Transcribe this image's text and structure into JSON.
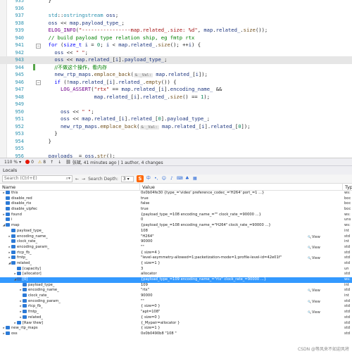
{
  "editor": {
    "lines": [
      {
        "n": "935",
        "html": "  }"
      },
      {
        "n": "936",
        "html": ""
      },
      {
        "n": "937",
        "html": "  <span class=\"ty\">std</span>::<span class=\"ty\">ostringstream</span> <span class=\"var\">oss</span>;"
      },
      {
        "n": "938",
        "html": "  <span class=\"var\">oss</span> << <span class=\"var\">map</span>.<span class=\"var\">payload_type_</span>;"
      },
      {
        "n": "939",
        "html": "  <span class=\"mac\">ELOG_INFO</span>(<span class=\"st\">\"----------------map.related_.size: %d\"</span>, <span class=\"var\">map</span>.<span class=\"var\">related_</span>.<span class=\"fn\">size</span>());"
      },
      {
        "n": "940",
        "html": "  <span class=\"cm\">// build payload type relation ship, eg fmtp rtx</span>"
      },
      {
        "n": "941",
        "html": "  <span class=\"kw\">for</span> (<span class=\"kw\">size_t</span> <span class=\"var\">i</span> = <span class=\"num\">0</span>; <span class=\"var\">i</span> < <span class=\"var\">map</span>.<span class=\"var\">related_</span>.<span class=\"fn\">size</span>(); ++<span class=\"var\">i</span>) {"
      },
      {
        "n": "942",
        "html": "    <span class=\"var\">oss</span> << <span class=\"st\">\" \"</span>;"
      },
      {
        "n": "943",
        "html": "    <span class=\"var\">oss</span> << <span class=\"var\">map</span>.<span class=\"var\">related_</span>[<span class=\"var\">i</span>].<span class=\"var\">payload_type_</span>;",
        "hl": true
      },
      {
        "n": "944",
        "html": "    <span class=\"cm-cn\">//不做这个操作，看内存</span>"
      },
      {
        "n": "945",
        "html": "    <span class=\"var\">new_rtp_maps</span>.<span class=\"fn\">emplace_back</span>(<span class=\"hint\">&amp; _Val:</span> <span class=\"var\">map</span>.<span class=\"var\">related_</span>[<span class=\"var\">i</span>]);"
      },
      {
        "n": "946",
        "html": "    <span class=\"kw\">if</span> (!<span class=\"var\">map</span>.<span class=\"var\">related_</span>[<span class=\"var\">i</span>].<span class=\"var\">related_</span>.<span class=\"fn\">empty</span>()) {"
      },
      {
        "n": "947",
        "html": "      <span class=\"mac\">LOG_ASSERT</span>(<span class=\"st\">\"rtx\"</span> == <span class=\"var\">map</span>.<span class=\"var\">related_</span>[<span class=\"var\">i</span>].<span class=\"var\">encoding_name_</span> &amp;&amp;"
      },
      {
        "n": "948",
        "html": "                 <span class=\"var\">map</span>.<span class=\"var\">related_</span>[<span class=\"var\">i</span>].<span class=\"var\">related_</span>.<span class=\"fn\">size</span>() == <span class=\"num\">1</span>);"
      },
      {
        "n": "949",
        "html": ""
      },
      {
        "n": "950",
        "html": "      <span class=\"var\">oss</span> << <span class=\"st\">\" \"</span>;"
      },
      {
        "n": "951",
        "html": "      <span class=\"var\">oss</span> << <span class=\"var\">map</span>.<span class=\"var\">related_</span>[<span class=\"var\">i</span>].<span class=\"var\">related_</span>[<span class=\"num\">0</span>].<span class=\"var\">payload_type_</span>;"
      },
      {
        "n": "952",
        "html": "      <span class=\"var\">new_rtp_maps</span>.<span class=\"fn\">emplace_back</span>(<span class=\"hint\">&amp; _Val:</span> <span class=\"var\">map</span>.<span class=\"var\">related_</span>[<span class=\"var\">i</span>].<span class=\"var\">related_</span>[<span class=\"num\">0</span>]);"
      },
      {
        "n": "953",
        "html": "    }"
      },
      {
        "n": "954",
        "html": "  }"
      },
      {
        "n": "955",
        "html": ""
      },
      {
        "n": "956",
        "html": "  <span class=\"var\">payloads_</span> = <span class=\"var\">oss</span>.<span class=\"fn\">str</span>();"
      },
      {
        "n": "957",
        "html": ""
      }
    ]
  },
  "strip": {
    "zoom": "110 %",
    "errors": "0",
    "warnings": "8",
    "nav_up": "↑",
    "nav_down": "↓",
    "blame": "张斌, 41 minutes ago | 1 author, 4 changes"
  },
  "locals": {
    "title": "Locals",
    "search_placeholder": "Search (Ctrl+E)",
    "search_depth_label": "Search Depth:",
    "search_depth_value": "3",
    "col_name": "Name",
    "col_value": "Value",
    "col_type": "Typ",
    "rows": [
      {
        "indent": 0,
        "tw": "▸",
        "name": "this",
        "value": "0x0b04fe30 {type_='video' preference_codec_='H264' port_=1 ...}",
        "type": "ws:",
        "view": ""
      },
      {
        "indent": 0,
        "tw": "",
        "name": "disable_red",
        "value": "true",
        "type": "boc",
        "view": ""
      },
      {
        "indent": 0,
        "tw": "",
        "name": "disable_rtx",
        "value": "false",
        "type": "boc",
        "view": ""
      },
      {
        "indent": 0,
        "tw": "",
        "name": "disable_ulpfec",
        "value": "true",
        "type": "boc",
        "view": ""
      },
      {
        "indent": 0,
        "tw": "▸",
        "name": "found",
        "value": "{payload_type_=108 encoding_name_=\"\" clock_rate_=90000 ...}",
        "type": "ws:",
        "view": ""
      },
      {
        "indent": 0,
        "tw": "",
        "name": "i",
        "value": "0",
        "type": "uns",
        "view": ""
      },
      {
        "indent": 0,
        "tw": "◢",
        "name": "map",
        "value": "{payload_type_=108 encoding_name_=\"H264\" clock_rate_=90000 ...}",
        "type": "ws:",
        "view": ""
      },
      {
        "indent": 1,
        "tw": "",
        "name": "payload_type_",
        "value": "108",
        "type": "int",
        "view": ""
      },
      {
        "indent": 1,
        "tw": "▸",
        "name": "encoding_name_",
        "value": "\"H264\"",
        "type": "std",
        "view": "View"
      },
      {
        "indent": 1,
        "tw": "",
        "name": "clock_rate_",
        "value": "90000",
        "type": "int",
        "view": ""
      },
      {
        "indent": 1,
        "tw": "▸",
        "name": "encoding_param_",
        "value": "\"\"",
        "type": "std",
        "view": "View"
      },
      {
        "indent": 1,
        "tw": "▸",
        "name": "rtcp_fb_",
        "value": "{ size=4 }",
        "type": "std",
        "view": ""
      },
      {
        "indent": 1,
        "tw": "▸",
        "name": "fmtp_",
        "value": "\"level-asymmetry-allowed=1;packetization-mode=1;profile-level-id=42e01f\"",
        "type": "std",
        "view": "View"
      },
      {
        "indent": 1,
        "tw": "◢",
        "name": "related_",
        "value": "{ size=1 }",
        "type": "std",
        "view": ""
      },
      {
        "indent": 2,
        "tw": "",
        "name": "[capacity]",
        "value": "3",
        "type": "un",
        "view": ""
      },
      {
        "indent": 2,
        "tw": "▸",
        "name": "[allocator]",
        "value": "allocator",
        "type": "std",
        "view": ""
      },
      {
        "indent": 2,
        "tw": "◢",
        "name": "[0]",
        "value": "{payload_type_=109 encoding_name_=\"rtx\" clock_rate_=90000 ...}",
        "type": "ws:",
        "view": "",
        "sel": true
      },
      {
        "indent": 3,
        "tw": "",
        "name": "payload_type_",
        "value": "109",
        "type": "int",
        "view": ""
      },
      {
        "indent": 3,
        "tw": "▸",
        "name": "encoding_name_",
        "value": "\"rtx\"",
        "type": "std",
        "view": "View"
      },
      {
        "indent": 3,
        "tw": "",
        "name": "clock_rate_",
        "value": "90000",
        "type": "int",
        "view": ""
      },
      {
        "indent": 3,
        "tw": "▸",
        "name": "encoding_param_",
        "value": "\"\"",
        "type": "std",
        "view": "View"
      },
      {
        "indent": 3,
        "tw": "▸",
        "name": "rtcp_fb_",
        "value": "{ size=0 }",
        "type": "std",
        "view": ""
      },
      {
        "indent": 3,
        "tw": "▸",
        "name": "fmtp_",
        "value": "\"apt=108\"",
        "type": "std",
        "view": "View"
      },
      {
        "indent": 3,
        "tw": "▸",
        "name": "related_",
        "value": "{ size=0 }",
        "type": "std",
        "view": ""
      },
      {
        "indent": 2,
        "tw": "▸",
        "name": "[Raw View]",
        "value": "{_Mypair=allocator }",
        "type": "std",
        "view": ""
      },
      {
        "indent": 0,
        "tw": "▸",
        "name": "new_rtp_maps",
        "value": "{ size=1 }",
        "type": "std",
        "view": ""
      },
      {
        "indent": 0,
        "tw": "▸",
        "name": "oss",
        "value": "0x0b0490b8 \"108 \"",
        "type": "std",
        "view": ""
      }
    ]
  },
  "watermark": "CSDN @等风来不如迎风将"
}
